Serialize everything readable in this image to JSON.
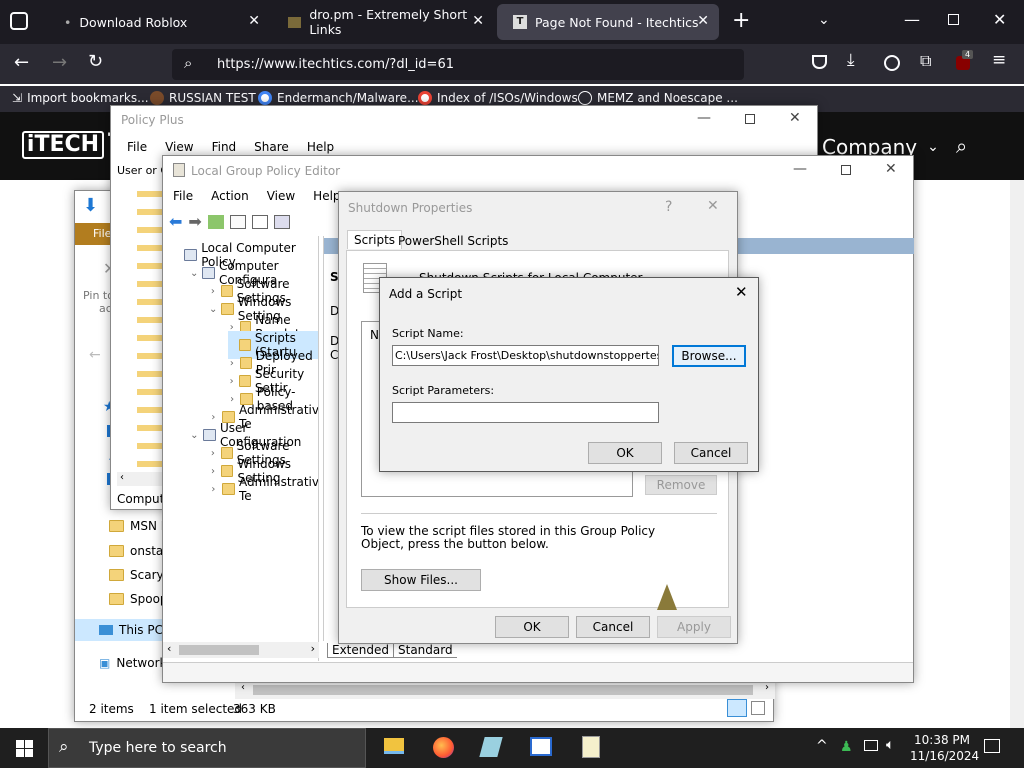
{
  "browser": {
    "tabs": [
      {
        "title": "Download Roblox"
      },
      {
        "title": "dro.pm - Extremely Short Links"
      },
      {
        "title": "Page Not Found - Itechtics"
      }
    ],
    "new_tab": "+",
    "url": "https://www.itechtics.com/?dl_id=61",
    "extension_badge": "4",
    "bookmarks": [
      {
        "label": "Import bookmarks..."
      },
      {
        "label": "RUSSIAN TEST"
      },
      {
        "label": "Endermanch/Malware..."
      },
      {
        "label": "Index of /ISOs/Windows"
      },
      {
        "label": "MEMZ and Noescape ..."
      }
    ]
  },
  "site": {
    "logo": "iTECH",
    "logo_trail": "T",
    "nav_item": "Company"
  },
  "policy_plus": {
    "title": "Policy Plus",
    "menu": [
      "File",
      "View",
      "Find",
      "Share",
      "Help"
    ],
    "left_label": "User or Co",
    "status": "Compute"
  },
  "explorer": {
    "ribbon_tab": "File",
    "pin_label": "Pin to",
    "pin_label2": "ac",
    "items": [
      "MSN N",
      "onstar",
      "Scary S",
      "Spoop"
    ],
    "this_pc": "This PC",
    "network": "Network",
    "status_items": "2 items",
    "status_selected": "1 item selected",
    "status_size": "363 KB"
  },
  "gpedit": {
    "title": "Local Group Policy Editor",
    "menu": [
      "File",
      "Action",
      "View",
      "Help"
    ],
    "tree": [
      {
        "label": "Local Computer Policy",
        "indent": 0
      },
      {
        "label": "Computer Configura",
        "indent": 1
      },
      {
        "label": "Software Settings",
        "indent": 2
      },
      {
        "label": "Windows Setting",
        "indent": 2
      },
      {
        "label": "Name Resolut",
        "indent": 3
      },
      {
        "label": "Scripts (Startu",
        "indent": 3
      },
      {
        "label": "Deployed Prir",
        "indent": 3
      },
      {
        "label": "Security Settir",
        "indent": 3
      },
      {
        "label": "Policy-based",
        "indent": 3
      },
      {
        "label": "Administrative Te",
        "indent": 2
      },
      {
        "label": "User Configuration",
        "indent": 1
      },
      {
        "label": "Software Settings",
        "indent": 2
      },
      {
        "label": "Windows Setting",
        "indent": 2
      },
      {
        "label": "Administrative Te",
        "indent": 2
      }
    ],
    "panel_letters": [
      "Sh",
      "Di",
      "De",
      "Co"
    ],
    "tabs_bottom": [
      "Extended",
      "Standard"
    ]
  },
  "shutdown": {
    "title": "Shutdown Properties",
    "help": "?",
    "tabs": [
      "Scripts",
      "PowerShell Scripts"
    ],
    "heading": "Shutdown Scripts for Local Computer",
    "list_col": "Na",
    "remove": "Remove",
    "info": "To view the script files stored in this Group Policy Object, press the button below.",
    "show_files": "Show Files...",
    "ok": "OK",
    "cancel": "Cancel",
    "apply": "Apply"
  },
  "add_script": {
    "title": "Add a Script",
    "name_label": "Script Name:",
    "name_value": "C:\\Users\\Jack Frost\\Desktop\\shutdownstoppertes.txt",
    "browse": "Browse...",
    "params_label": "Script Parameters:",
    "params_value": "",
    "ok": "OK",
    "cancel": "Cancel"
  },
  "taskbar": {
    "search_placeholder": "Type here to search",
    "time": "10:38 PM",
    "date": "11/16/2024"
  }
}
